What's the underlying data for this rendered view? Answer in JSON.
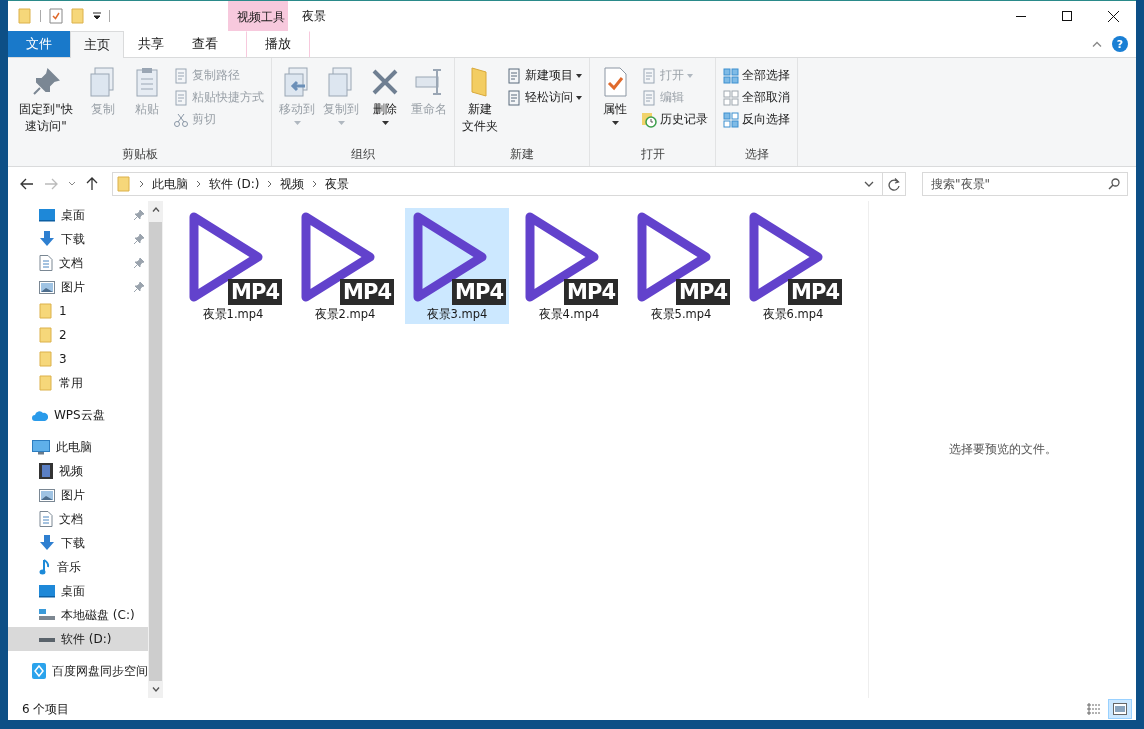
{
  "window": {
    "title": "夜景",
    "contextual_tab": "视频工具",
    "help": "?"
  },
  "tabs": [
    {
      "label": "文件",
      "kind": "file",
      "selected": false
    },
    {
      "label": "主页",
      "kind": "normal",
      "selected": true
    },
    {
      "label": "共享",
      "kind": "normal",
      "selected": false
    },
    {
      "label": "查看",
      "kind": "normal",
      "selected": false
    },
    {
      "label": "播放",
      "kind": "contextual",
      "selected": false
    }
  ],
  "ribbon": {
    "groups": [
      {
        "label": "剪贴板",
        "commands": [
          {
            "lines": [
              "固定到\"快速访问\""
            ],
            "kind": "large",
            "disabled": false,
            "dropdown": false
          },
          {
            "lines": [
              "复制"
            ],
            "kind": "large",
            "disabled": true,
            "dropdown": false
          },
          {
            "lines": [
              "粘贴"
            ],
            "kind": "large",
            "disabled": true,
            "dropdown": false
          },
          {
            "lines": [
              "复制路径"
            ],
            "kind": "small",
            "disabled": true,
            "dropdown": false
          },
          {
            "lines": [
              "粘贴快捷方式"
            ],
            "kind": "small",
            "disabled": true,
            "dropdown": false
          },
          {
            "lines": [
              "剪切"
            ],
            "kind": "small",
            "disabled": true,
            "dropdown": false
          }
        ]
      },
      {
        "label": "组织",
        "commands": [
          {
            "lines": [
              "移动到"
            ],
            "kind": "large",
            "disabled": true,
            "dropdown": true
          },
          {
            "lines": [
              "复制到"
            ],
            "kind": "large",
            "disabled": true,
            "dropdown": true
          },
          {
            "lines": [
              "删除"
            ],
            "kind": "large",
            "disabled": false,
            "dropdown": true
          },
          {
            "lines": [
              "重命名"
            ],
            "kind": "large",
            "disabled": true,
            "dropdown": false
          }
        ]
      },
      {
        "label": "新建",
        "commands": [
          {
            "lines": [
              "新建",
              "文件夹"
            ],
            "kind": "large",
            "disabled": false,
            "dropdown": false
          },
          {
            "lines": [
              "新建项目"
            ],
            "kind": "small",
            "disabled": false,
            "dropdown": true
          },
          {
            "lines": [
              "轻松访问"
            ],
            "kind": "small",
            "disabled": false,
            "dropdown": true
          }
        ]
      },
      {
        "label": "打开",
        "commands": [
          {
            "lines": [
              "属性"
            ],
            "kind": "large",
            "disabled": false,
            "dropdown": true
          },
          {
            "lines": [
              "打开"
            ],
            "kind": "small",
            "disabled": true,
            "dropdown": true
          },
          {
            "lines": [
              "编辑"
            ],
            "kind": "small",
            "disabled": true,
            "dropdown": false
          },
          {
            "lines": [
              "历史记录"
            ],
            "kind": "small",
            "disabled": false,
            "dropdown": false
          }
        ]
      },
      {
        "label": "选择",
        "commands": [
          {
            "lines": [
              "全部选择"
            ],
            "kind": "small",
            "disabled": false,
            "dropdown": false
          },
          {
            "lines": [
              "全部取消"
            ],
            "kind": "small",
            "disabled": false,
            "dropdown": false
          },
          {
            "lines": [
              "反向选择"
            ],
            "kind": "small",
            "disabled": false,
            "dropdown": false
          }
        ]
      }
    ]
  },
  "address": {
    "breadcrumbs": [
      "此电脑",
      "软件 (D:)",
      "视频",
      "夜景"
    ],
    "search": {
      "placeholder": "搜索\"夜景\""
    }
  },
  "nav": {
    "sections": [
      {
        "children": [
          {
            "label": "桌面",
            "kind": "desktop",
            "pinned": true,
            "selected": false
          },
          {
            "label": "下载",
            "kind": "download",
            "pinned": true,
            "selected": false
          },
          {
            "label": "文档",
            "kind": "documents",
            "pinned": true,
            "selected": false
          },
          {
            "label": "图片",
            "kind": "pictures",
            "pinned": true,
            "selected": false
          },
          {
            "label": "1",
            "kind": "folder",
            "pinned": false,
            "selected": false
          },
          {
            "label": "2",
            "kind": "folder",
            "pinned": false,
            "selected": false
          },
          {
            "label": "3",
            "kind": "folder",
            "pinned": false,
            "selected": false
          },
          {
            "label": "常用",
            "kind": "folder",
            "pinned": false,
            "selected": false
          }
        ]
      },
      {
        "label": "WPS云盘",
        "kind": "cloud",
        "selected": false
      },
      {
        "label": "此电脑",
        "kind": "computer",
        "selected": false,
        "children": [
          {
            "label": "视频",
            "kind": "videos",
            "selected": false
          },
          {
            "label": "图片",
            "kind": "pictures",
            "selected": false
          },
          {
            "label": "文档",
            "kind": "documents",
            "selected": false
          },
          {
            "label": "下载",
            "kind": "download",
            "selected": false
          },
          {
            "label": "音乐",
            "kind": "music",
            "selected": false
          },
          {
            "label": "桌面",
            "kind": "desktop",
            "selected": false
          },
          {
            "label": "本地磁盘 (C:)",
            "kind": "systemdrive",
            "selected": false
          },
          {
            "label": "软件 (D:)",
            "kind": "drive",
            "selected": true
          }
        ]
      },
      {
        "label": "百度网盘同步空间",
        "kind": "sync",
        "selected": false
      }
    ]
  },
  "files": [
    {
      "name": "夜景1.mp4",
      "badge": "MP4",
      "selected": false
    },
    {
      "name": "夜景2.mp4",
      "badge": "MP4",
      "selected": false
    },
    {
      "name": "夜景3.mp4",
      "badge": "MP4",
      "selected": true
    },
    {
      "name": "夜景4.mp4",
      "badge": "MP4",
      "selected": false
    },
    {
      "name": "夜景5.mp4",
      "badge": "MP4",
      "selected": false
    },
    {
      "name": "夜景6.mp4",
      "badge": "MP4",
      "selected": false
    }
  ],
  "preview": {
    "message": "选择要预览的文件。"
  },
  "status_bar": {
    "count": "6 个项目",
    "views": [
      {
        "kind": "details",
        "selected": false
      },
      {
        "kind": "thumbnails",
        "selected": true
      }
    ]
  }
}
